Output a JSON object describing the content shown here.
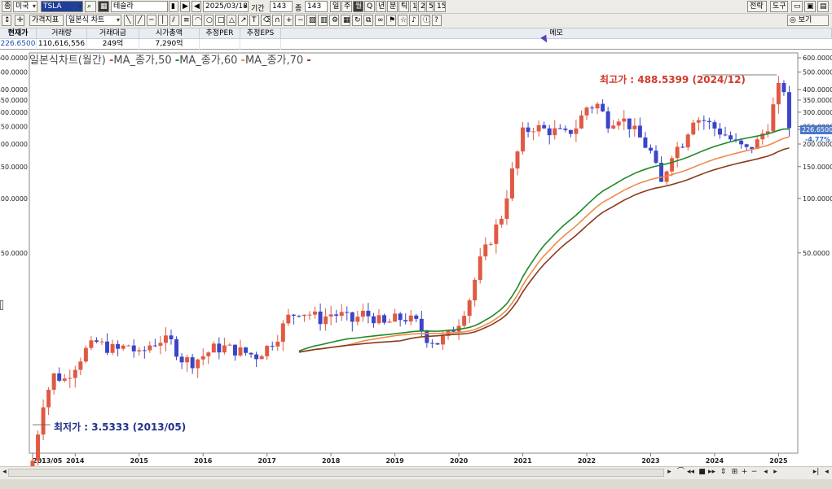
{
  "toolbar1": {
    "market_label": "종",
    "market": "미국",
    "ticker": "TSLA",
    "name": "테슬라",
    "date": "2025/03/18",
    "period_label": "기간",
    "period": "143",
    "count_label": "종",
    "count": "143",
    "tf_day": "일",
    "tf_week": "주",
    "tf_month": "월",
    "tf_q": "Q",
    "tf_year": "년",
    "tf_min": "분",
    "tf_tick": "틱",
    "n1": "1",
    "n2": "2",
    "n5": "5",
    "n15": "15",
    "strategy": "전략",
    "tools": "도구"
  },
  "toolbar2": {
    "price_index": "가격지표",
    "chart_type": "일본식 차트",
    "view": "보기"
  },
  "info": {
    "headers": [
      "현재가",
      "거래량",
      "거래대금",
      "시가총액",
      "추정PER",
      "추정EPS"
    ],
    "values": [
      "226.6500",
      "110,616,556",
      "249억",
      "7,290억",
      "",
      ""
    ],
    "memo_label": "메모"
  },
  "legend": {
    "title": "일본식차트(월간)",
    "ma50": "MA_종가,50",
    "ma60": "MA_종가,60",
    "ma70": "MA_종가,70"
  },
  "annotations": {
    "high": "최고가 : 488.5399 (2024/12)",
    "low": "최저가 : 3.5333 (2013/05)",
    "current": "226.6500",
    "change": "-4.77%"
  },
  "axes": {
    "right_ticks_labels": [
      "600.0000",
      "500.0000",
      "400.0000",
      "350.0000",
      "300.0000",
      "250.0000",
      "200.0000",
      "150.0000",
      "100.0000",
      "50.0000"
    ],
    "left_ticks_labels": [
      "600.0000",
      "500.0000",
      "400.0000",
      "350.0000",
      "300.0000",
      "250.0000",
      "200.0000",
      "150.0000",
      "100.0000",
      "50.0000"
    ],
    "x_labels": [
      "2013/05",
      "2014",
      "2015",
      "2016",
      "2017",
      "2018",
      "2019",
      "2020",
      "2021",
      "2022",
      "2023",
      "2024",
      "2025"
    ]
  },
  "colors": {
    "up": "#e05a43",
    "down": "#3a45c8",
    "ma50": "#1f8a2a",
    "ma60": "#f08a4b",
    "ma70": "#8b3a1a"
  },
  "chart_data": {
    "type": "candlestick",
    "title": "일본식차트(월간)",
    "scale": "log",
    "ylim": [
      28,
      650
    ],
    "x": [
      "2013/05",
      "2014",
      "2015",
      "2016",
      "2017",
      "2018",
      "2019",
      "2020",
      "2021",
      "2022",
      "2023",
      "2024",
      "2025"
    ],
    "series": [
      {
        "name": "MA_종가,50",
        "values": []
      },
      {
        "name": "MA_종가,60",
        "values": []
      },
      {
        "name": "MA_종가,70",
        "values": []
      }
    ],
    "highest": {
      "value": 488.5399,
      "date": "2024/12"
    },
    "lowest": {
      "value": 3.5333,
      "date": "2013/05"
    },
    "last_close": 226.65
  }
}
